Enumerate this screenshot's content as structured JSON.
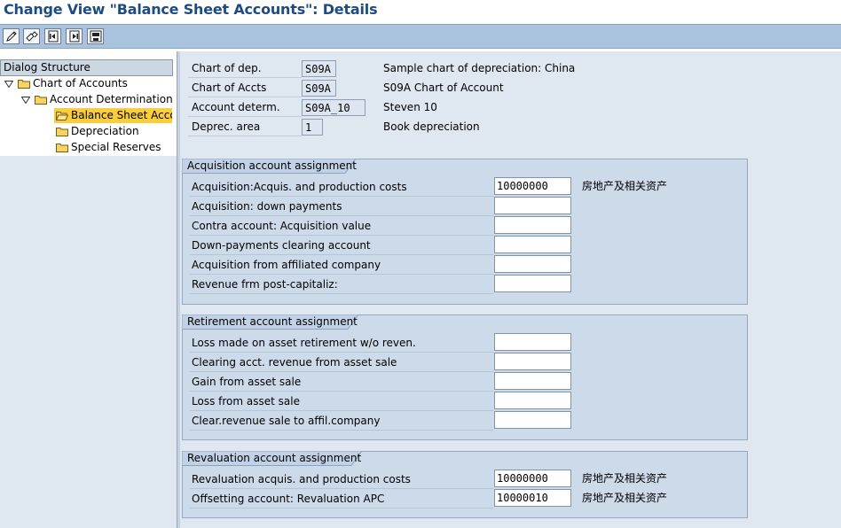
{
  "window": {
    "title": "Change View \"Balance Sheet Accounts\": Details"
  },
  "toolbar": {
    "buttons": [
      {
        "icon": "pencil-icon"
      },
      {
        "icon": "display-change-icon"
      },
      {
        "icon": "previous-entry-icon"
      },
      {
        "icon": "next-entry-icon"
      },
      {
        "icon": "save-list-icon"
      }
    ]
  },
  "dialog_structure": {
    "header": "Dialog Structure",
    "items": [
      {
        "label": "Chart of Accounts",
        "level": 0,
        "expanded": true
      },
      {
        "label": "Account Determination",
        "level": 1,
        "expanded": true
      },
      {
        "label": "Balance Sheet Accou",
        "level": 2,
        "selected": true
      },
      {
        "label": "Depreciation",
        "level": 2
      },
      {
        "label": "Special Reserves",
        "level": 2
      }
    ]
  },
  "header_fields": [
    {
      "label": "Chart of dep.",
      "value": "S09A",
      "description": "Sample chart of depreciation: China"
    },
    {
      "label": "Chart of Accts",
      "value": "S09A",
      "description": "S09A Chart of Account"
    },
    {
      "label": "Account determ.",
      "value": "S09A_10",
      "description": "Steven 10"
    },
    {
      "label": "Deprec. area",
      "value": "1",
      "description": "Book depreciation"
    }
  ],
  "groups": [
    {
      "title": "Acquisition account assignment",
      "rows": [
        {
          "label": "Acquisition:Acquis. and production costs",
          "value": "10000000",
          "description": "房地产及相关资产"
        },
        {
          "label": "Acquisition: down payments",
          "value": "",
          "description": ""
        },
        {
          "label": "Contra account: Acquisition value",
          "value": "",
          "description": ""
        },
        {
          "label": "Down-payments clearing account",
          "value": "",
          "description": ""
        },
        {
          "label": "Acquisition from affiliated company",
          "value": "",
          "description": ""
        },
        {
          "label": "Revenue frm post-capitaliz:",
          "value": "",
          "description": ""
        }
      ]
    },
    {
      "title": "Retirement account assignment",
      "rows": [
        {
          "label": "Loss made on asset retirement w/o reven.",
          "value": "",
          "description": ""
        },
        {
          "label": "Clearing acct. revenue from asset sale",
          "value": "",
          "description": ""
        },
        {
          "label": "Gain from asset sale",
          "value": "",
          "description": ""
        },
        {
          "label": "Loss from asset sale",
          "value": "",
          "description": ""
        },
        {
          "label": "Clear.revenue sale to affil.company",
          "value": "",
          "description": ""
        }
      ]
    },
    {
      "title": "Revaluation account assignment",
      "rows": [
        {
          "label": "Revaluation acquis. and production costs",
          "value": "10000000",
          "description": "房地产及相关资产"
        },
        {
          "label": "Offsetting account: Revaluation APC",
          "value": "10000010",
          "description": "房地产及相关资产"
        }
      ]
    }
  ],
  "colors": {
    "title": "#1f4c80",
    "toolbar": "#a9c2dd",
    "content_bg": "#dfe7f0",
    "group_bg": "#cddaea",
    "selected_item": "#f9cd3c"
  }
}
